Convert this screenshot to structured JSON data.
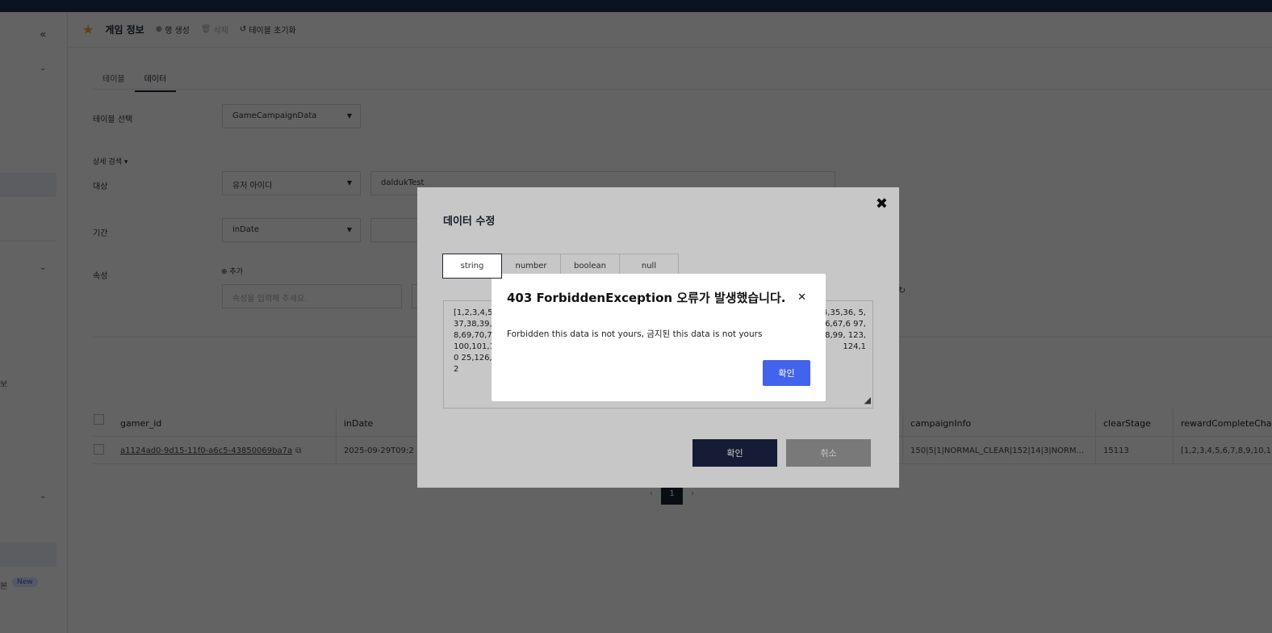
{
  "header": {
    "title": "게임 정보",
    "add_row": "행 생성",
    "delete": "삭제",
    "reset_table": "테이블 초기화"
  },
  "sidebar": {
    "new_badge": "New",
    "tail_text_1": "보",
    "tail_text_2": "본"
  },
  "tabs": [
    {
      "label": "테이블"
    },
    {
      "label": "데이터",
      "active": true
    }
  ],
  "filters": {
    "table_select_label": "테이블 선택",
    "table_select_value": "GameCampaignData",
    "advanced_search": "상세 검색",
    "target_label": "대상",
    "target_select_value": "유저 아이디",
    "target_input_value": "daldukTest",
    "period_label": "기간",
    "period_select_value": "inDate",
    "attribute_label": "속성",
    "add_label": "추가",
    "attribute_placeholder": "속성을 입력해 주세요."
  },
  "table": {
    "headers": [
      "gamer_id",
      "inDate",
      "campaignInfo",
      "clearStage",
      "rewardCompleteCha"
    ],
    "row": {
      "gamer_id": "a1124ad0-9d15-11f0-a6c5-43850069ba7a",
      "inDate": "2025-09-29T09:2",
      "campaignInfo": "150|5|1|NORMAL_CLEAR|152|14|3|NORM...",
      "clearStage": "15113",
      "rewardCompleteCha": "[1,2,3,4,5,6,7,8,9,10,1"
    }
  },
  "pagination": {
    "current": "1"
  },
  "edit_modal": {
    "title": "데이터 수정",
    "types": [
      "string",
      "number",
      "boolean",
      "null"
    ],
    "active_type": "string",
    "value_left": "[1,2,3,4,5 37,38,39, 8,69,70,7 100,101,10 25,126,12",
    "value_right": "4,35,36, 5,66,67,6 97,98,99, 123,124,1",
    "ok": "확인",
    "cancel": "취소"
  },
  "error_dialog": {
    "title": "403 ForbiddenException 오류가 발생했습니다.",
    "message": "Forbidden this data is not yours, 금지된 this data is not yours",
    "ok": "확인"
  }
}
